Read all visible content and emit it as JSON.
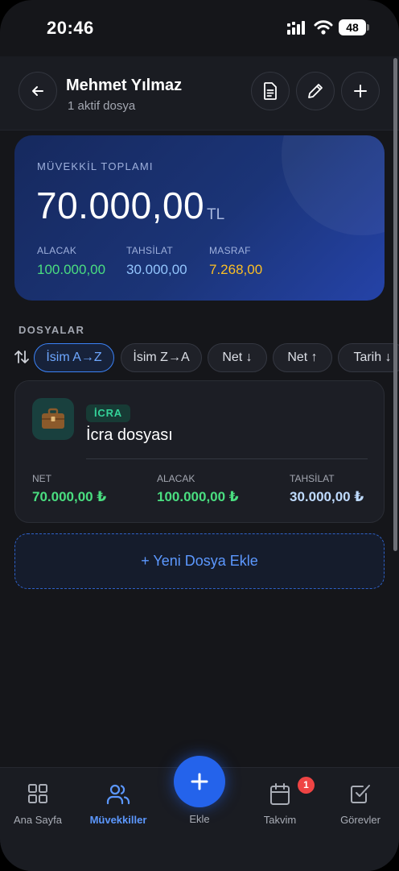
{
  "status_bar": {
    "time": "20:46",
    "battery": "48"
  },
  "header": {
    "title": "Mehmet Yılmaz",
    "subtitle": "1 aktif dosya"
  },
  "summary": {
    "label": "MÜVEKKİL TOPLAMI",
    "amount": "70.000,00",
    "currency": "TL",
    "alacak": {
      "label": "ALACAK",
      "value": "100.000,00",
      "color": "#4ade80"
    },
    "tahsilat": {
      "label": "TAHSİLAT",
      "value": "30.000,00",
      "color": "#93c5fd"
    },
    "masraf": {
      "label": "MASRAF",
      "value": "7.268,00",
      "color": "#fbbf24"
    }
  },
  "files_section": {
    "title": "DOSYALAR",
    "sort_chips": [
      "İsim A→Z",
      "İsim Z→A",
      "Net ↓",
      "Net ↑",
      "Tarih ↓"
    ],
    "active_chip": "İsim A→Z"
  },
  "file_card": {
    "badge": "İCRA",
    "name": "İcra dosyası",
    "icon": "briefcase-icon",
    "net": {
      "label": "NET",
      "value": "70.000,00 ₺",
      "color": "#4ade80"
    },
    "alacak": {
      "label": "ALACAK",
      "value": "100.000,00 ₺",
      "color": "#4ade80"
    },
    "tahsilat": {
      "label": "TAHSİLAT",
      "value": "30.000,00 ₺",
      "color": "#bfdbfe"
    }
  },
  "add_file": {
    "label": "+ Yeni Dosya Ekle"
  },
  "tab_bar": {
    "home": "Ana Sayfa",
    "clients": "Müvekkiller",
    "add": "Ekle",
    "calendar": "Takvim",
    "calendar_badge": "1",
    "tasks": "Görevler",
    "active": "Müvekkiller"
  }
}
